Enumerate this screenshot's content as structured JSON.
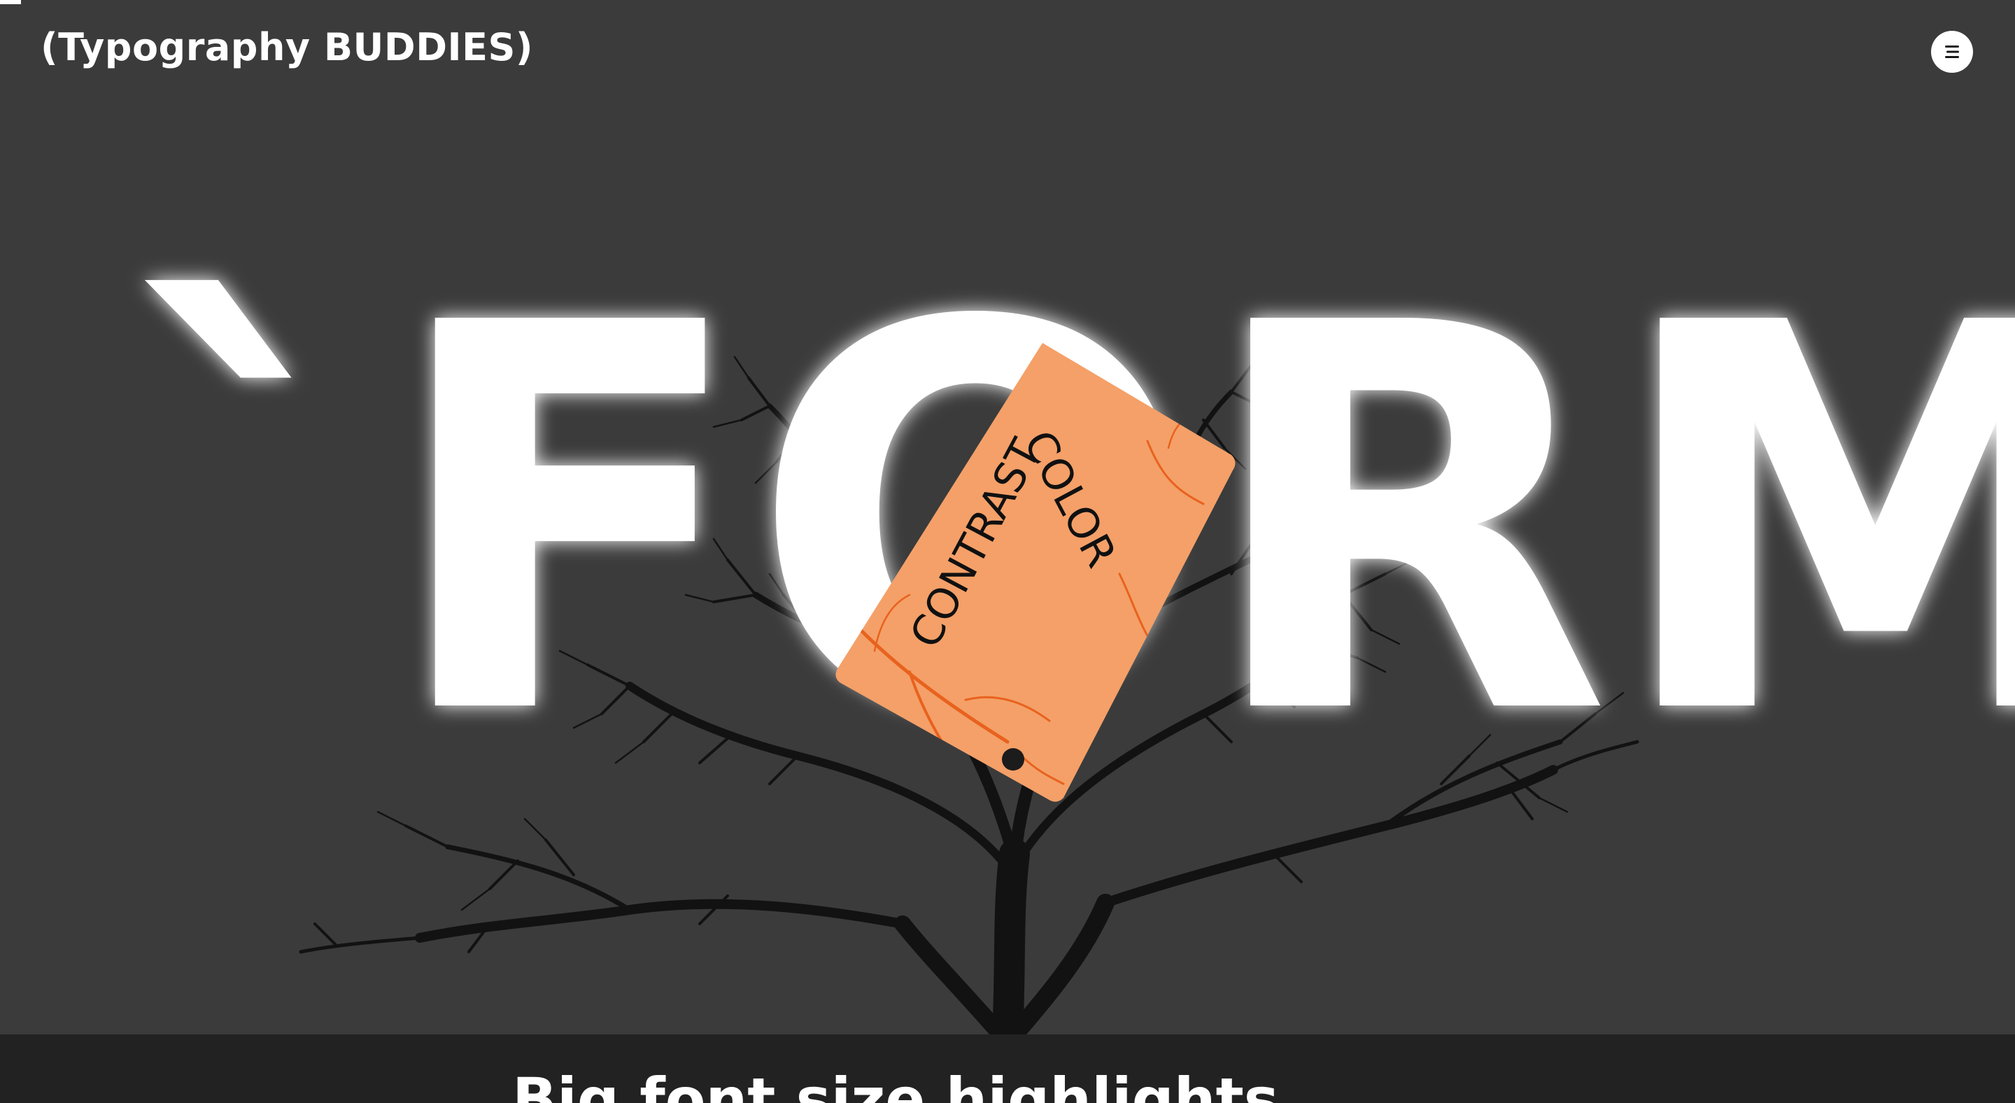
{
  "header": {
    "brand": "(Typography BUDDIES)",
    "menu_icon": "menu-icon"
  },
  "hero": {
    "headline": "`FORM",
    "tag_text": [
      "COLOR",
      "CONTRAST"
    ],
    "tag_icon": "price-tag-icon",
    "background_icon": "bare-tree-icon"
  },
  "section": {
    "title": "Big font size highlights"
  },
  "colors": {
    "background": "#3b3b3b",
    "band": "#222222",
    "headline": "#ffffff",
    "tag": "#f4a068",
    "tag_branch": "#e8621e",
    "tree": "#121212"
  }
}
